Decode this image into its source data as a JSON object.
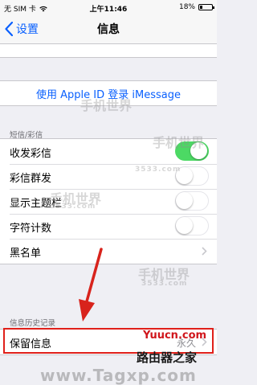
{
  "status_bar": {
    "carrier": "无 SIM 卡",
    "time": "上午11:46",
    "battery": "18%",
    "battery_level": 0.18
  },
  "nav": {
    "back_label": "设置",
    "title": "信息"
  },
  "imessage_link": "使用 Apple ID 登录 iMessage",
  "sms_section": {
    "header": "短信/彩信",
    "rows": [
      {
        "label": "收发彩信",
        "toggle_on": true
      },
      {
        "label": "彩信群发",
        "toggle_on": false
      },
      {
        "label": "显示主题栏",
        "toggle_on": false
      },
      {
        "label": "字符计数",
        "toggle_on": false
      },
      {
        "label": "黑名单"
      }
    ]
  },
  "history_section": {
    "header": "信息历史记录",
    "rows": [
      {
        "label": "保留信息",
        "value": "永久"
      }
    ]
  },
  "watermarks": {
    "brand": "手机世界",
    "domain": "3533.com",
    "yuucn": "Yuucn.com",
    "site_logo": "路由器之家",
    "bottom": "www.Tagxp.com"
  },
  "colors": {
    "accent": "#0a60fe",
    "toggle_on": "#4cd964",
    "highlight": "#e0201a"
  }
}
